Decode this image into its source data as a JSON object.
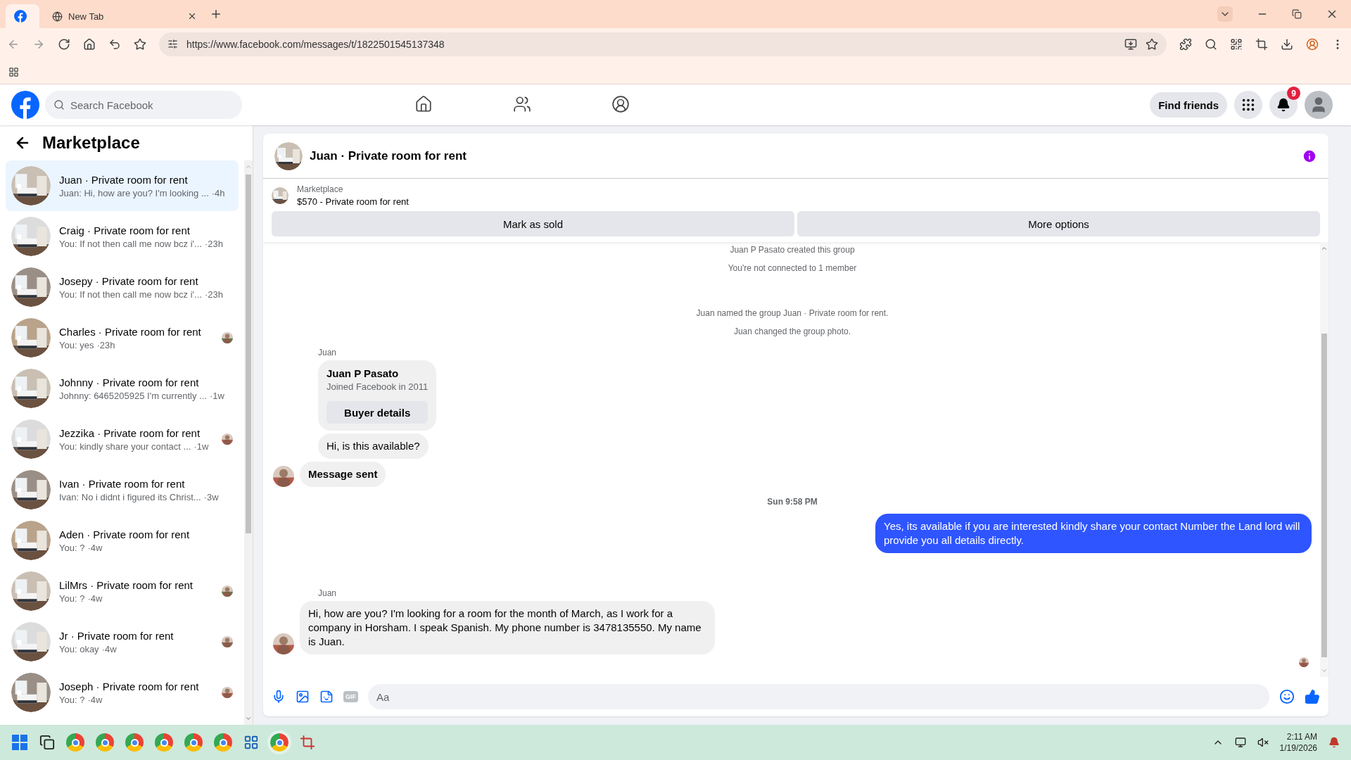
{
  "browser": {
    "tabs": [
      {
        "kind": "icon",
        "selected": true
      },
      {
        "kind": "text",
        "label": "New Tab",
        "selected": false
      }
    ],
    "url": "https://www.facebook.com/messages/t/1822501545137348"
  },
  "header": {
    "search_placeholder": "Search Facebook",
    "nav": [
      {
        "selected": false
      },
      {
        "selected": false
      },
      {
        "selected": false
      }
    ],
    "find_friends": "Find friends",
    "notification_count": "9"
  },
  "sidebar": {
    "title": "Marketplace",
    "items": [
      {
        "name": "Juan · Private room for rent",
        "preview": "Juan: Hi, how are you? I'm looking ...",
        "time": "·4h",
        "selected": true,
        "seen": false
      },
      {
        "name": "Craig · Private room for rent",
        "preview": "You: If not then call me now bcz i'...",
        "time": "·23h",
        "selected": false,
        "seen": false
      },
      {
        "name": "Josepy · Private room for rent",
        "preview": "You: If not then call me now bcz i'...",
        "time": "·23h",
        "selected": false,
        "seen": false
      },
      {
        "name": "Charles · Private room for rent",
        "preview": "You: yes",
        "time": "·23h",
        "selected": false,
        "seen": true
      },
      {
        "name": "Johnny · Private room for rent",
        "preview": "Johnny: 6465205925 I'm currently ...",
        "time": "·1w",
        "selected": false,
        "seen": false
      },
      {
        "name": "Jezzika · Private room for rent",
        "preview": "You: kindly share your contact ...",
        "time": "·1w",
        "selected": false,
        "seen": true
      },
      {
        "name": "Ivan · Private room for rent",
        "preview": "Ivan: No i didnt i figured its Christ...",
        "time": "·3w",
        "selected": false,
        "seen": false
      },
      {
        "name": "Aden · Private room for rent",
        "preview": "You: ?",
        "time": "·4w",
        "selected": false,
        "seen": false
      },
      {
        "name": "LilMrs · Private room for rent",
        "preview": "You: ?",
        "time": "·4w",
        "selected": false,
        "seen": true
      },
      {
        "name": "Jr · Private room for rent",
        "preview": "You: okay",
        "time": "·4w",
        "selected": false,
        "seen": true
      },
      {
        "name": "Joseph · Private room for rent",
        "preview": "You: ?",
        "time": "·4w",
        "selected": false,
        "seen": true
      }
    ]
  },
  "chat": {
    "title": "Juan · Private room for rent",
    "listing_label": "Marketplace",
    "listing": "$570 - Private room for rent",
    "buttons": [
      "Mark as sold",
      "More options"
    ],
    "messages": [
      {
        "kind": "system",
        "text": "Juan P Pasato created this group"
      },
      {
        "kind": "system",
        "text": "You're not connected to 1 member"
      },
      {
        "kind": "gap"
      },
      {
        "kind": "system",
        "text": "Juan named the group Juan · Private room for rent."
      },
      {
        "kind": "system",
        "text": "Juan changed the group photo."
      },
      {
        "kind": "sender",
        "text": "Juan"
      },
      {
        "kind": "card",
        "title": "Juan P Pasato",
        "subtitle": "Joined Facebook in 2011",
        "button": "Buyer details"
      },
      {
        "kind": "incoming",
        "text": "Hi, is this available?",
        "avatar": false,
        "bold": false
      },
      {
        "kind": "incoming",
        "text": "Message sent",
        "avatar": true,
        "bold": true
      },
      {
        "kind": "time",
        "text": "Sun 9:58 PM"
      },
      {
        "kind": "outgoing",
        "text": "Yes, its available if you are interested kindly share your contact Number the Land lord will provide you all details directly."
      },
      {
        "kind": "gap"
      },
      {
        "kind": "sender",
        "text": "Juan"
      },
      {
        "kind": "incoming",
        "text": "Hi, how are you? I'm looking for a room for the month of March, as I work for a company in Horsham. I speak Spanish. My phone number is 3478135550. My name is Juan.",
        "avatar": true,
        "bold": false
      },
      {
        "kind": "seen"
      }
    ],
    "composer": {
      "gif_label": "GIF",
      "placeholder": "Aa"
    }
  },
  "taskbar": {
    "time": "2:11 AM",
    "date": "1/19/2026"
  }
}
